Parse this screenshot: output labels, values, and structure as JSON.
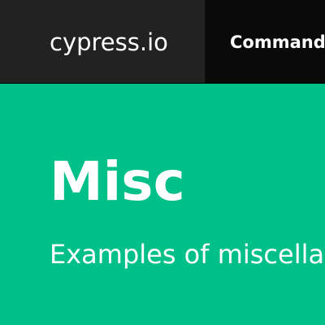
{
  "navbar": {
    "brand": "cypress.io",
    "links": [
      {
        "label": "Commands"
      }
    ]
  },
  "hero": {
    "title": "Misc",
    "subtitle": "Examples of miscellaneous commands in Cypress"
  },
  "colors": {
    "navbar_bg": "#0a0a0a",
    "brand_bg": "#222222",
    "hero_bg": "#00c08a",
    "text": "#ffffff"
  }
}
